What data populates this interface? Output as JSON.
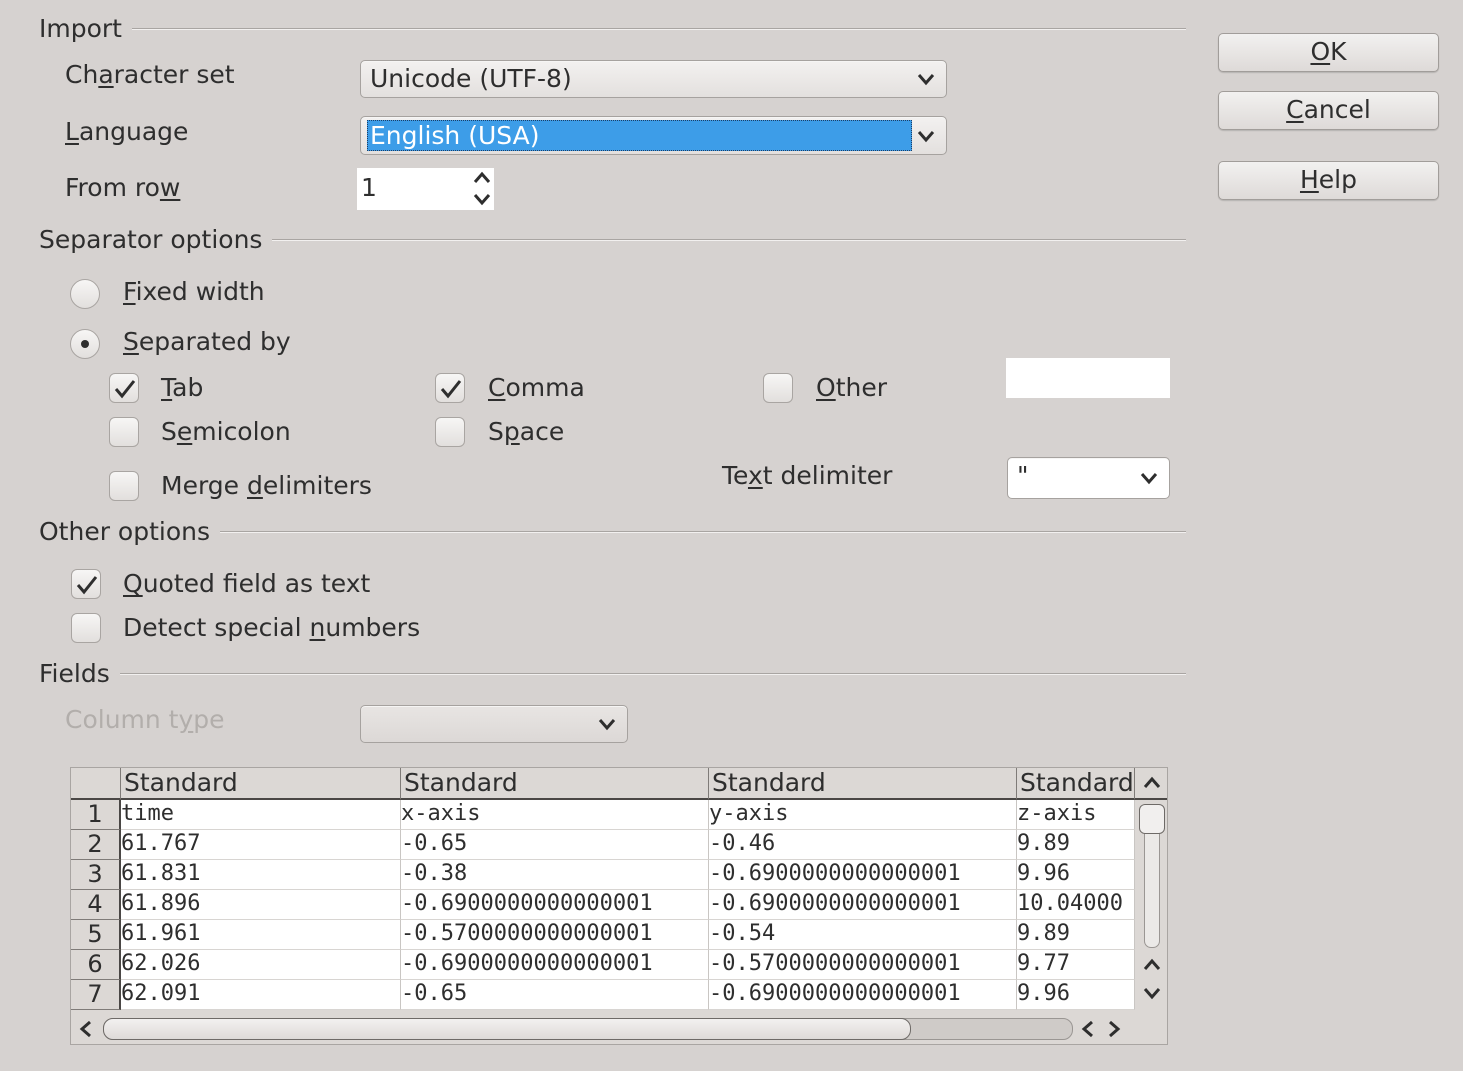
{
  "import": {
    "title": "Import",
    "charset_label_pre": "Ch",
    "charset_label_u": "a",
    "charset_label_post": "racter set",
    "charset_value": "Unicode (UTF-8)",
    "language_label_u": "L",
    "language_label_post": "anguage",
    "language_value": "English (USA)",
    "fromrow_label_pre": "From ro",
    "fromrow_label_u": "w",
    "fromrow_value": "1"
  },
  "buttons": {
    "ok_u": "O",
    "ok_post": "K",
    "cancel_u": "C",
    "cancel_post": "ancel",
    "help_u": "H",
    "help_post": "elp"
  },
  "separator": {
    "title": "Separator options",
    "fixed_u": "F",
    "fixed_post": "ixed width",
    "fixed_checked": false,
    "separated_u": "S",
    "separated_post": "eparated by",
    "separated_checked": true,
    "tab_u": "T",
    "tab_post": "ab",
    "tab_checked": true,
    "comma_u": "C",
    "comma_post": "omma",
    "comma_checked": true,
    "other_u": "O",
    "other_post": "ther",
    "other_checked": false,
    "semicolon_pre": "S",
    "semicolon_u": "e",
    "semicolon_post": "micolon",
    "semicolon_checked": false,
    "space_pre": "S",
    "space_u": "p",
    "space_post": "ace",
    "space_checked": false,
    "merge_pre": "Merge ",
    "merge_u": "d",
    "merge_post": "elimiters",
    "merge_checked": false,
    "textdelim_pre": "Te",
    "textdelim_u": "x",
    "textdelim_post": "t delimiter",
    "textdelim_value": "\""
  },
  "other": {
    "title": "Other options",
    "quoted_u": "Q",
    "quoted_post": "uoted field as text",
    "quoted_checked": true,
    "detect_pre": "Detect special ",
    "detect_u": "n",
    "detect_post": "umbers",
    "detect_checked": false
  },
  "fields": {
    "title": "Fields",
    "coltype_pre": "Column t",
    "coltype_u": "y",
    "coltype_post": "pe",
    "columns": [
      "Standard",
      "Standard",
      "Standard",
      "Standard"
    ],
    "rows": [
      {
        "num": "1",
        "cells": [
          "time",
          "x-axis",
          "y-axis",
          "z-axis"
        ]
      },
      {
        "num": "2",
        "cells": [
          "61.767",
          " -0.65",
          " -0.46",
          " 9.89"
        ]
      },
      {
        "num": "3",
        "cells": [
          "61.831",
          " -0.38",
          " -0.6900000000000001",
          " 9.96"
        ]
      },
      {
        "num": "4",
        "cells": [
          "61.896",
          " -0.6900000000000001",
          " -0.6900000000000001",
          " 10.04000"
        ]
      },
      {
        "num": "5",
        "cells": [
          "61.961",
          " -0.5700000000000001",
          " -0.54",
          " 9.89"
        ]
      },
      {
        "num": "6",
        "cells": [
          "62.026",
          " -0.6900000000000001",
          " -0.5700000000000001",
          " 9.77"
        ]
      },
      {
        "num": "7",
        "cells": [
          "62.091",
          " -0.65",
          " -0.6900000000000001",
          " 9.96"
        ]
      }
    ]
  }
}
